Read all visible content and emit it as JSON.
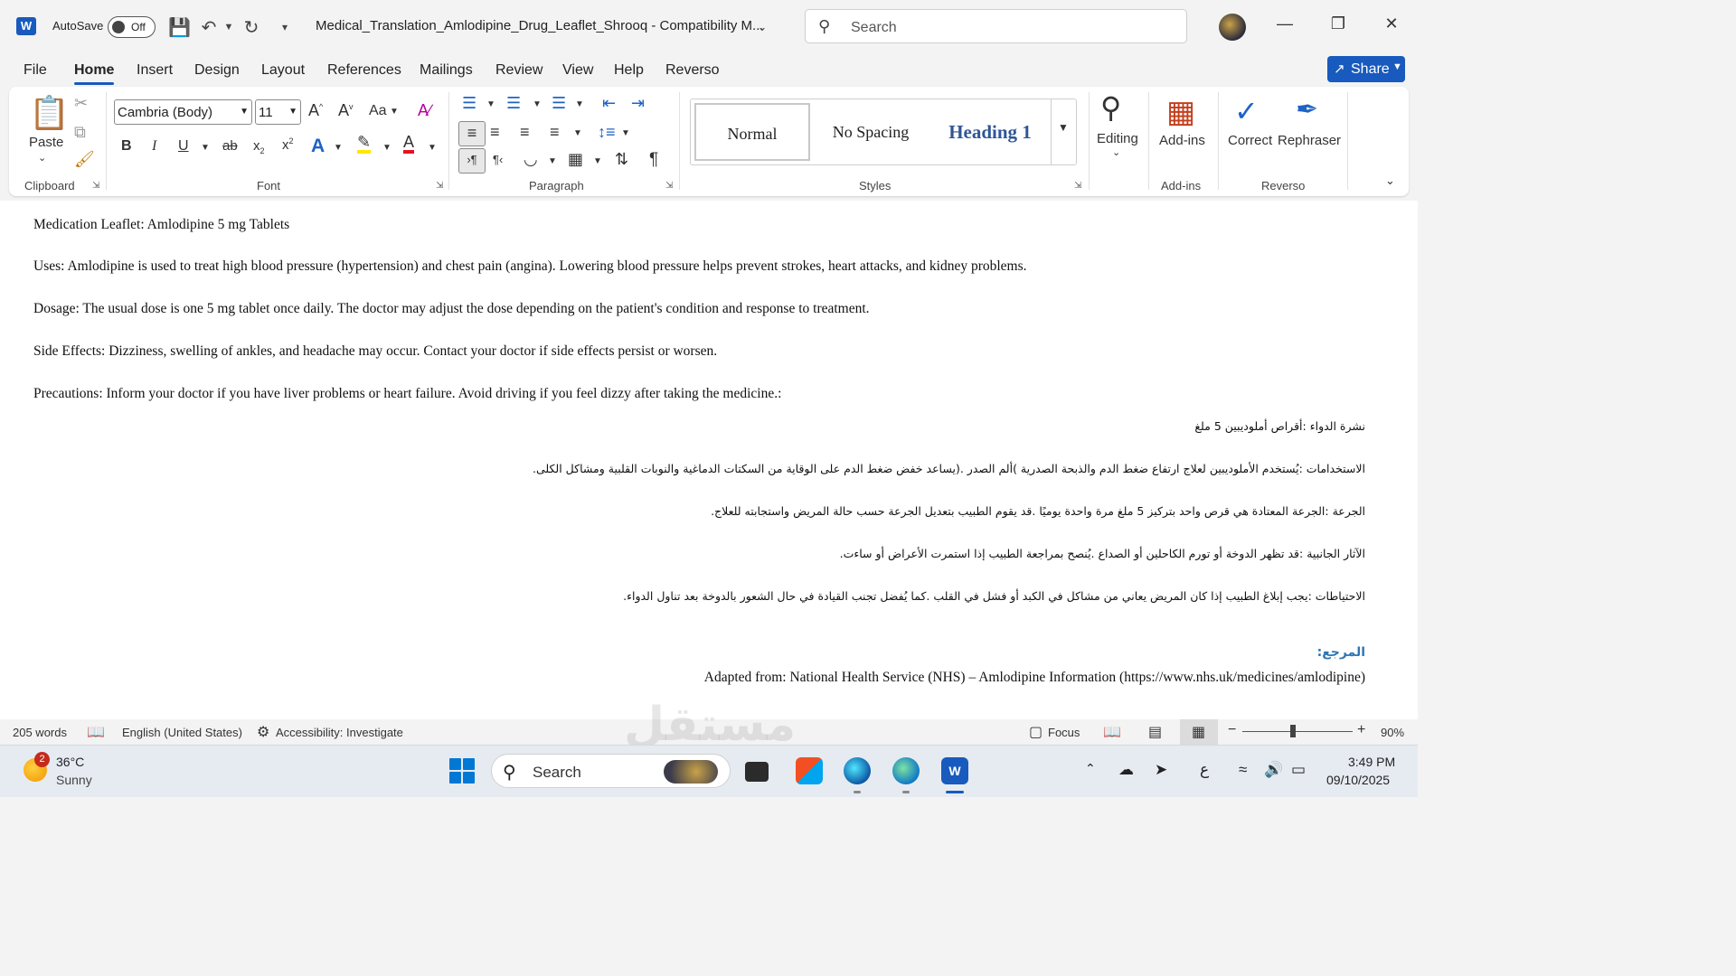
{
  "titlebar": {
    "app_letter": "W",
    "autosave_label": "AutoSave",
    "autosave_state": "Off",
    "doc_title": "Medical_Translation_Amlodipine_Drug_Leaflet_Shrooq  -  Compatibility M...",
    "search_placeholder": "Search"
  },
  "menu": {
    "tabs": [
      "File",
      "Home",
      "Insert",
      "Design",
      "Layout",
      "References",
      "Mailings",
      "Review",
      "View",
      "Help",
      "Reverso"
    ],
    "active": "Home",
    "share_label": "Share"
  },
  "ribbon": {
    "clipboard": {
      "paste_label": "Paste",
      "group_label": "Clipboard"
    },
    "font": {
      "font_name": "Cambria (Body)",
      "font_size": "11",
      "group_label": "Font",
      "case_label": "Aa"
    },
    "paragraph": {
      "group_label": "Paragraph"
    },
    "styles": {
      "items": [
        "Normal",
        "No Spacing",
        "Heading 1"
      ],
      "group_label": "Styles"
    },
    "editing": {
      "label": "Editing"
    },
    "addins": {
      "label": "Add-ins",
      "group_label": "Add-ins"
    },
    "reverso": {
      "correct_label": "Correct",
      "rephraser_label": "Rephraser",
      "group_label": "Reverso"
    }
  },
  "document": {
    "en": [
      "Medication Leaflet: Amlodipine 5 mg Tablets",
      "Uses: Amlodipine is used to treat high blood pressure (hypertension) and chest pain (angina). Lowering blood pressure helps prevent strokes, heart attacks, and kidney problems.",
      "Dosage: The usual dose is one 5 mg tablet once daily. The doctor may adjust the dose depending on the patient's condition and response to treatment.",
      "Side Effects: Dizziness, swelling of ankles, and headache may occur. Contact your doctor if side effects persist or worsen.",
      "Precautions: Inform your doctor if you have liver problems or heart failure. Avoid driving if you feel dizzy after taking the medicine.:"
    ],
    "ar": [
      "نشرة الدواء :أقراص أملوديبين 5 ملغ",
      "الاستخدامات :يُستخدم الأملوديبين لعلاج ارتفاع ضغط الدم والذبحة الصدرية )ألم الصدر .(يساعد خفض ضغط الدم على الوقاية من السكتات الدماغية والنوبات القلبية ومشاكل الكلى.",
      "الجرعة :الجرعة المعتادة هي قرص واحد بتركيز 5 ملغ مرة واحدة يوميًا .قد يقوم الطبيب بتعديل الجرعة حسب حالة المريض واستجابته للعلاج.",
      "الآثار الجانبية :قد تظهر الدوخة أو تورم الكاحلين أو الصداع .يُنصح بمراجعة الطبيب إذا استمرت الأعراض أو ساءت.",
      "الاحتياطات :يجب إبلاغ الطبيب إذا كان المريض يعاني من مشاكل في الكبد أو فشل في القلب .كما يُفضل تجنب القيادة في حال الشعور بالدوخة بعد تناول الدواء."
    ],
    "reference_heading": "المرجع:",
    "reference_text": "Adapted from: National Health Service (NHS) – Amlodipine Information (https://www.nhs.uk/medicines/amlodipine)"
  },
  "statusbar": {
    "words": "205 words",
    "language": "English (United States)",
    "accessibility": "Accessibility: Investigate",
    "focus": "Focus",
    "zoom": "90%"
  },
  "watermark": "مستقل",
  "taskbar": {
    "weather_badge": "2",
    "temperature": "36°C",
    "condition": "Sunny",
    "search_placeholder": "Search",
    "input_lang": "ع",
    "time": "3:49 PM",
    "date": "09/10/2025"
  },
  "colors": {
    "word_blue": "#185abd",
    "heading_blue": "#2e75b6",
    "highlight_yellow": "#ffe600",
    "font_color_red": "#e81123"
  }
}
